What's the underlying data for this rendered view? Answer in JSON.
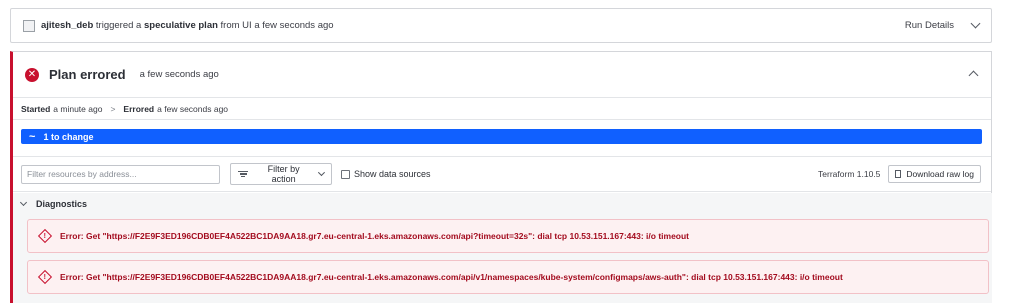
{
  "trigger": {
    "user": "ajitesh_deb",
    "text1": "triggered a",
    "plan_type": "speculative plan",
    "text2": "from UI a few seconds ago",
    "run_details_label": "Run Details"
  },
  "plan": {
    "status_title": "Plan errored",
    "status_time": "a few seconds ago",
    "started_label": "Started",
    "started_value": "a minute ago",
    "separator": ">",
    "errored_label": "Errored",
    "errored_value": "a few seconds ago",
    "change_bar": {
      "symbol": "~",
      "label": "1 to change"
    }
  },
  "filters": {
    "search_placeholder": "Filter resources by address...",
    "filter_action_label": "Filter by action",
    "show_data_sources_label": "Show data sources",
    "terraform_version": "Terraform 1.10.5",
    "download_label": "Download raw log"
  },
  "diagnostics": {
    "title": "Diagnostics",
    "items": [
      {
        "icon": "warning-diamond-icon",
        "message": "Error: Get \"https://F2E9F3ED196CDB0EF4A522BC1DA9AA18.gr7.eu-central-1.eks.amazonaws.com/api?timeout=32s\": dial tcp 10.53.151.167:443: i/o timeout"
      },
      {
        "icon": "warning-diamond-icon",
        "message": "Error: Get \"https://F2E9F3ED196CDB0EF4A522BC1DA9AA18.gr7.eu-central-1.eks.amazonaws.com/api/v1/namespaces/kube-system/configmaps/aws-auth\": dial tcp 10.53.151.167:443: i/o timeout"
      }
    ]
  },
  "colors": {
    "error": "#c8102e",
    "accent": "#1060ff"
  }
}
